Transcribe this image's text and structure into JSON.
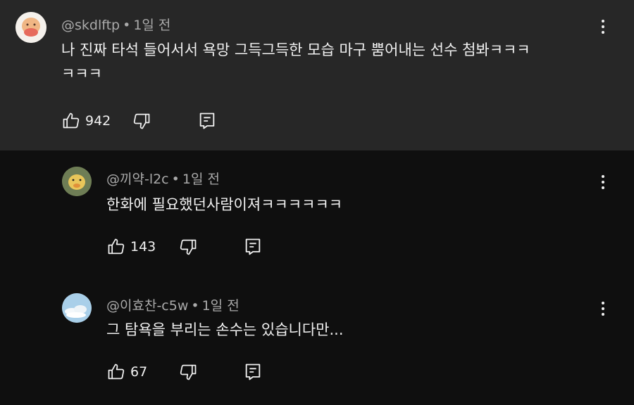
{
  "comments": [
    {
      "author": "@skdlftp",
      "time": "1일 전",
      "text_line1": "나 진짜 타석 들어서서  욕망 그득그득한 모습 마구 뿜어내는 선수 첨봐ㅋㅋㅋ",
      "text_line2": "ㅋㅋㅋ",
      "likes": "942"
    },
    {
      "author": "@끼약-l2c",
      "time": "1일 전",
      "text": "한화에 필요했던사람이져ㅋㅋㅋㅋㅋㅋ",
      "likes": "143"
    },
    {
      "author": "@이효찬-c5w",
      "time": "1일 전",
      "text": "그 탐욕을 부리는 손수는 있습니다만...",
      "likes": "67"
    }
  ],
  "separator": "•",
  "icons": {
    "like": "thumb-up-icon",
    "dislike": "thumb-down-icon",
    "reply": "reply-icon",
    "more": "more-vert-icon"
  },
  "colors": {
    "highlight_bg": "#272727",
    "page_bg": "#0f0f0f",
    "meta_text": "#aaaaaa",
    "text": "#f1f1f1"
  }
}
